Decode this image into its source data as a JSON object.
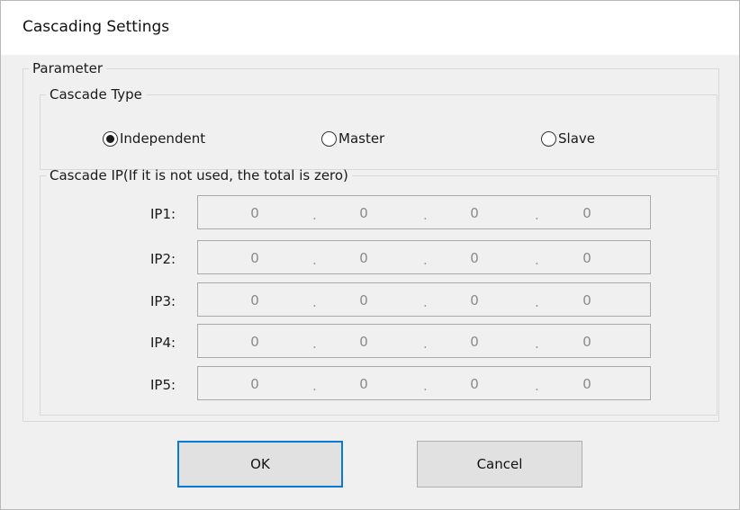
{
  "window": {
    "title": "Cascading Settings"
  },
  "parameter": {
    "legend": "Parameter",
    "cascade_type": {
      "legend": "Cascade Type",
      "options": [
        {
          "label": "Independent",
          "checked": true
        },
        {
          "label": "Master",
          "checked": false
        },
        {
          "label": "Slave",
          "checked": false
        }
      ]
    },
    "cascade_ip": {
      "legend": "Cascade IP(If it is not used, the total is zero)",
      "separator": ".",
      "rows": [
        {
          "label": "IP1:",
          "octets": [
            "0",
            "0",
            "0",
            "0"
          ]
        },
        {
          "label": "IP2:",
          "octets": [
            "0",
            "0",
            "0",
            "0"
          ]
        },
        {
          "label": "IP3:",
          "octets": [
            "0",
            "0",
            "0",
            "0"
          ]
        },
        {
          "label": "IP4:",
          "octets": [
            "0",
            "0",
            "0",
            "0"
          ]
        },
        {
          "label": "IP5:",
          "octets": [
            "0",
            "0",
            "0",
            "0"
          ]
        }
      ]
    }
  },
  "buttons": {
    "ok": "OK",
    "cancel": "Cancel"
  }
}
